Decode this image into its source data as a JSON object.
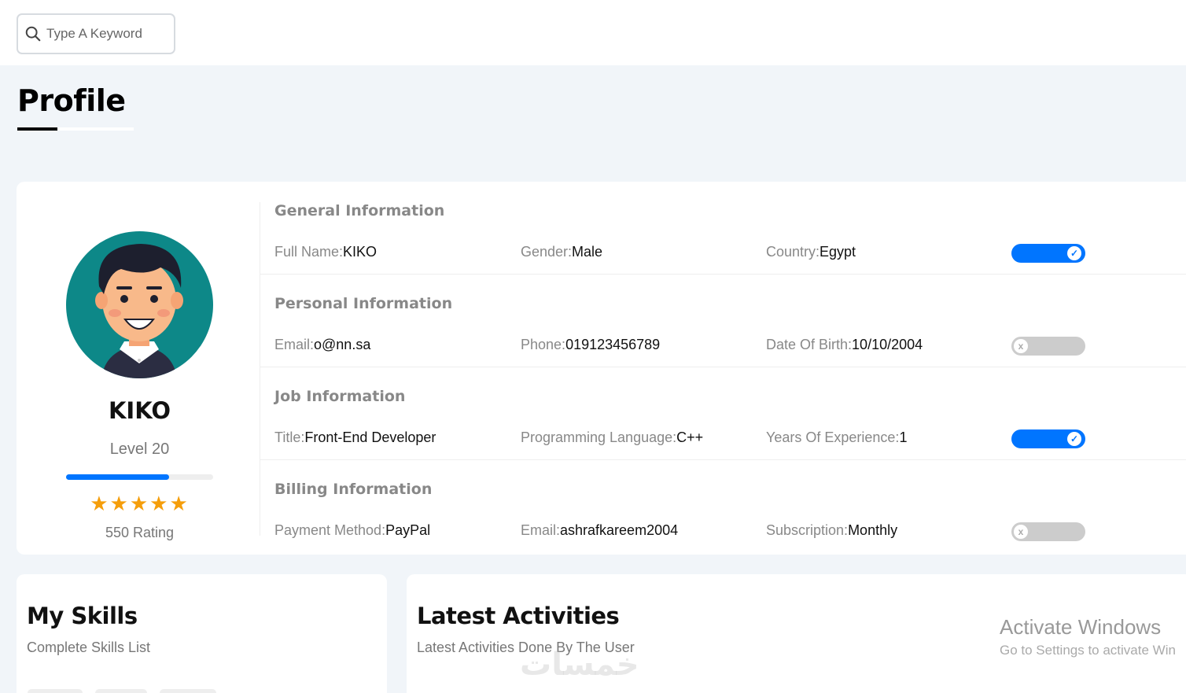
{
  "search": {
    "placeholder": "Type A Keyword"
  },
  "page": {
    "title": "Profile"
  },
  "profile": {
    "name": "KIKO",
    "level": "Level 20",
    "level_progress": 0.7,
    "stars": "★★★★★",
    "star_count": 5,
    "rating": "550 Rating"
  },
  "sections": [
    {
      "title": "General Information",
      "fields": [
        {
          "label": "Full Name:",
          "value": "KIKO"
        },
        {
          "label": "Gender:",
          "value": "Male"
        },
        {
          "label": "Country:",
          "value": "Egypt"
        }
      ],
      "toggle": true
    },
    {
      "title": "Personal Information",
      "fields": [
        {
          "label": "Email:",
          "value": "o@nn.sa"
        },
        {
          "label": "Phone:",
          "value": "019123456789"
        },
        {
          "label": "Date Of Birth:",
          "value": "10/10/2004"
        }
      ],
      "toggle": false
    },
    {
      "title": "Job Information",
      "fields": [
        {
          "label": "Title:",
          "value": "Front-End Developer"
        },
        {
          "label": "Programming Language:",
          "value": "C++"
        },
        {
          "label": "Years Of Experience:",
          "value": "1"
        }
      ],
      "toggle": true
    },
    {
      "title": "Billing Information",
      "fields": [
        {
          "label": "Payment Method:",
          "value": "PayPal"
        },
        {
          "label": "Email:",
          "value": "ashrafkareem2004"
        },
        {
          "label": "Subscription:",
          "value": "Monthly"
        }
      ],
      "toggle": false
    }
  ],
  "skills": {
    "title": "My Skills",
    "subtitle": "Complete Skills List"
  },
  "activities": {
    "title": "Latest Activities",
    "subtitle": "Latest Activities Done By The User"
  },
  "watermark": {
    "line1": "Activate Windows",
    "line2": "Go to Settings to activate Win"
  },
  "overlay_mark": "خمسات",
  "colors": {
    "accent": "#0075ff",
    "avatar_bg": "#0d8888",
    "star": "#f59e0b"
  }
}
